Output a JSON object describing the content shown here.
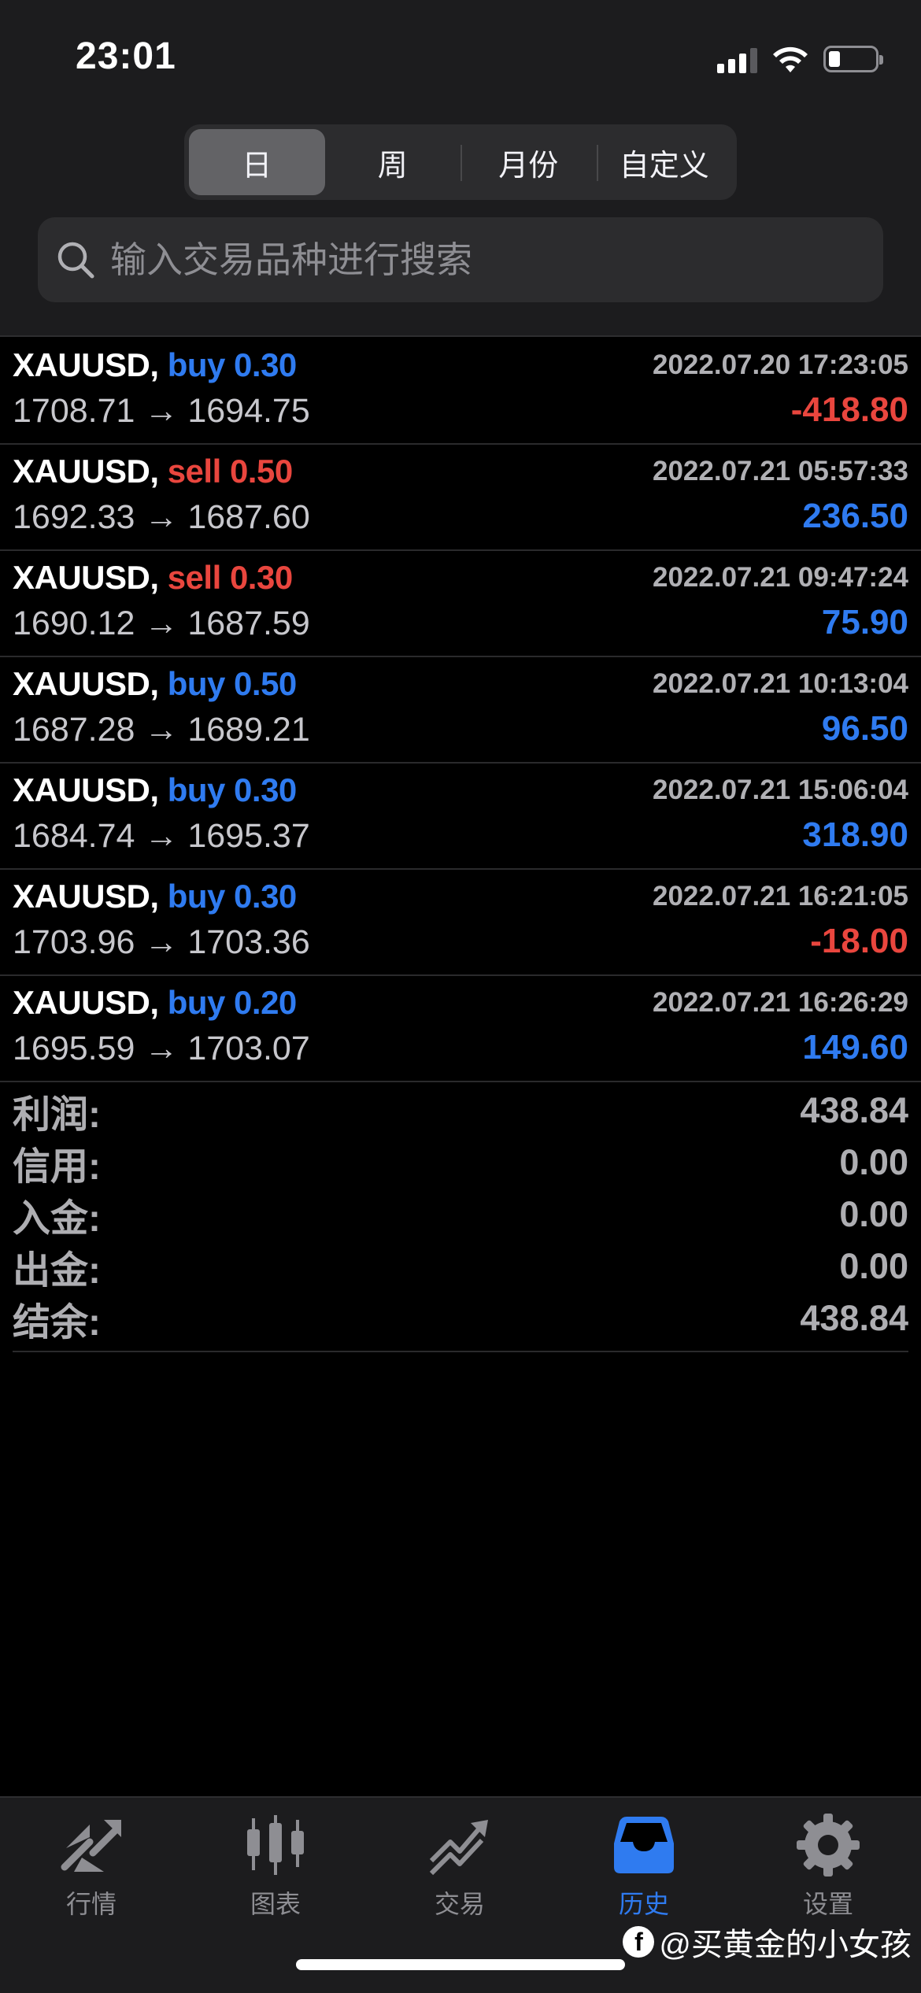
{
  "status_bar": {
    "time": "23:01"
  },
  "period_tabs": [
    {
      "label": "日",
      "active": true
    },
    {
      "label": "周",
      "active": false
    },
    {
      "label": "月份",
      "active": false
    },
    {
      "label": "自定义",
      "active": false
    }
  ],
  "search": {
    "placeholder": "输入交易品种进行搜索",
    "icon": "search-icon"
  },
  "trades": [
    {
      "symbol": "XAUUSD,",
      "side": "buy",
      "volume": "0.30",
      "time": "2022.07.20 17:23:05",
      "prices": "1708.71 → 1694.75",
      "profit": "-418.80"
    },
    {
      "symbol": "XAUUSD,",
      "side": "sell",
      "volume": "0.50",
      "time": "2022.07.21 05:57:33",
      "prices": "1692.33 → 1687.60",
      "profit": "236.50"
    },
    {
      "symbol": "XAUUSD,",
      "side": "sell",
      "volume": "0.30",
      "time": "2022.07.21 09:47:24",
      "prices": "1690.12 → 1687.59",
      "profit": "75.90"
    },
    {
      "symbol": "XAUUSD,",
      "side": "buy",
      "volume": "0.50",
      "time": "2022.07.21 10:13:04",
      "prices": "1687.28 → 1689.21",
      "profit": "96.50"
    },
    {
      "symbol": "XAUUSD,",
      "side": "buy",
      "volume": "0.30",
      "time": "2022.07.21 15:06:04",
      "prices": "1684.74 → 1695.37",
      "profit": "318.90"
    },
    {
      "symbol": "XAUUSD,",
      "side": "buy",
      "volume": "0.30",
      "time": "2022.07.21 16:21:05",
      "prices": "1703.96 → 1703.36",
      "profit": "-18.00"
    },
    {
      "symbol": "XAUUSD,",
      "side": "buy",
      "volume": "0.20",
      "time": "2022.07.21 16:26:29",
      "prices": "1695.59 → 1703.07",
      "profit": "149.60"
    }
  ],
  "summary": [
    {
      "label": "利润:",
      "value": "438.84"
    },
    {
      "label": "信用:",
      "value": "0.00"
    },
    {
      "label": "入金:",
      "value": "0.00"
    },
    {
      "label": "出金:",
      "value": "0.00"
    },
    {
      "label": "结余:",
      "value": "438.84"
    }
  ],
  "tabbar": [
    {
      "label": "行情",
      "icon": "quotes-arrows-icon",
      "active": false
    },
    {
      "label": "图表",
      "icon": "candlestick-chart-icon",
      "active": false
    },
    {
      "label": "交易",
      "icon": "trade-trend-icon",
      "active": false
    },
    {
      "label": "历史",
      "icon": "history-inbox-icon",
      "active": true
    },
    {
      "label": "设置",
      "icon": "gear-icon",
      "active": false
    }
  ],
  "watermark": {
    "text": "@买黄金的小女孩"
  },
  "colors": {
    "positive": "#2f7bf0",
    "negative": "#e9463e",
    "accent": "#2f7bf0"
  }
}
